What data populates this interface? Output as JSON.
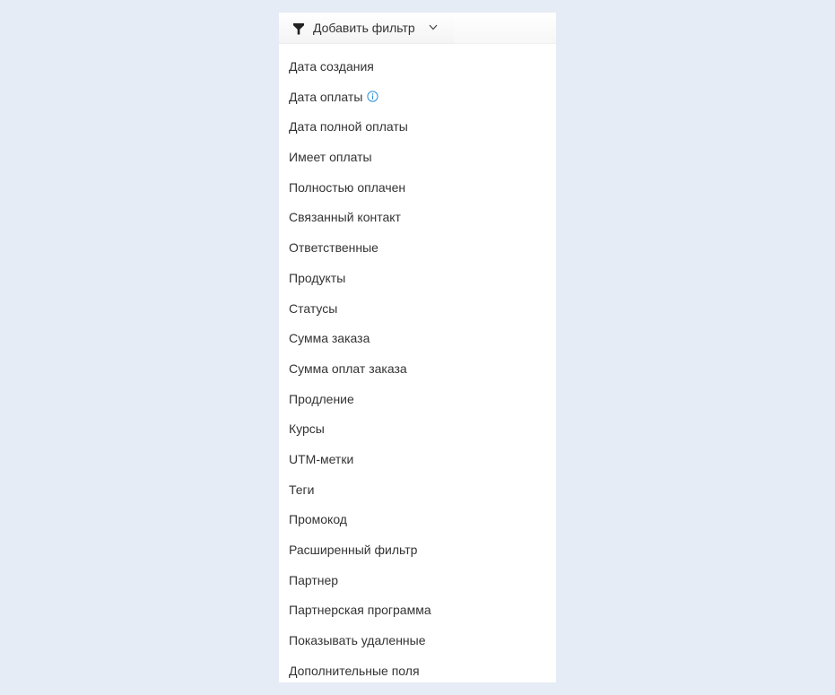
{
  "filter_button": {
    "label": "Добавить фильтр",
    "icon": "funnel-icon",
    "dropdown_icon": "chevron-down-icon"
  },
  "menu": {
    "items": [
      {
        "label": "Дата создания"
      },
      {
        "label": "Дата оплаты",
        "icon": "info-icon"
      },
      {
        "label": "Дата полной оплаты"
      },
      {
        "label": "Имеет оплаты"
      },
      {
        "label": "Полностью оплачен"
      },
      {
        "label": "Связанный контакт"
      },
      {
        "label": "Ответственные"
      },
      {
        "label": "Продукты"
      },
      {
        "label": "Статусы"
      },
      {
        "label": "Сумма заказа"
      },
      {
        "label": "Сумма оплат заказа"
      },
      {
        "label": "Продление"
      },
      {
        "label": "Курсы"
      },
      {
        "label": "UTM-метки"
      },
      {
        "label": "Теги"
      },
      {
        "label": "Промокод"
      },
      {
        "label": "Расширенный фильтр"
      },
      {
        "label": "Партнер"
      },
      {
        "label": "Партнерская программа"
      },
      {
        "label": "Показывать удаленные"
      },
      {
        "label": "Дополнительные поля"
      }
    ]
  },
  "colors": {
    "page_background": "#e5ecf5",
    "panel_background": "#ffffff",
    "text": "#333333",
    "info_icon": "#2d8fd6"
  }
}
